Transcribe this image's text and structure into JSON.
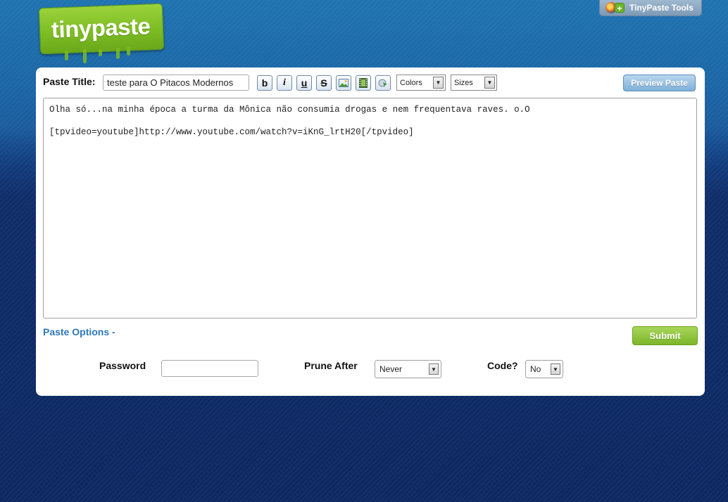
{
  "logo": {
    "text": "tinypaste"
  },
  "tools": {
    "label": "TinyPaste Tools"
  },
  "form": {
    "title_label": "Paste Title:",
    "title_value": "teste para O Pitacos Modernos",
    "toolbar": {
      "bold": "b",
      "italic": "i",
      "underline": "u",
      "strike": "S",
      "colors_label": "Colors",
      "sizes_label": "Sizes"
    },
    "preview_label": "Preview Paste",
    "paste_text": "Olha só...na minha época a turma da Mônica não consumia drogas e nem frequentava raves. o.O\n\n[tpvideo=youtube]http://www.youtube.com/watch?v=iKnG_lrtH20[/tpvideo]",
    "options_label": "Paste Options -",
    "submit_label": "Submit"
  },
  "options": {
    "password_label": "Password",
    "prune_label": "Prune After",
    "prune_value": "Never",
    "code_label": "Code?",
    "code_value": "No"
  },
  "colors": {
    "brand_green": "#7bbb22",
    "link_blue": "#2e78b7",
    "preview_blue": "#7fb0d9",
    "background_dark": "#0d2862"
  }
}
